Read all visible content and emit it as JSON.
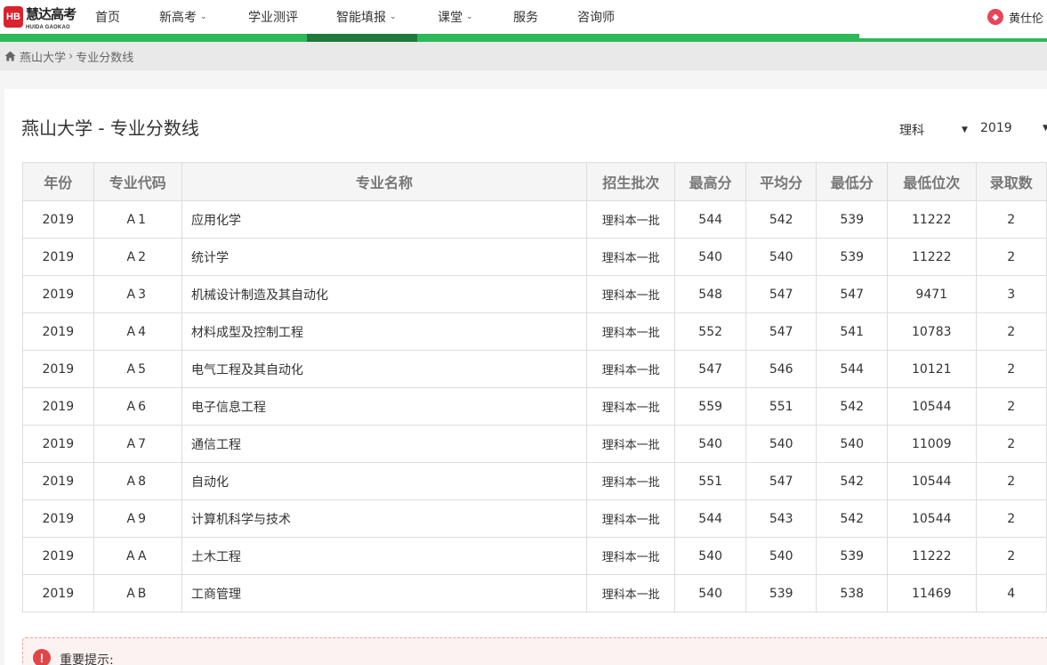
{
  "header": {
    "logo_badge": "HB",
    "logo_cn": "慧达高考",
    "logo_en": "HUIDA GAOKAO",
    "nav": [
      {
        "label": "首页",
        "dropdown": false
      },
      {
        "label": "新高考",
        "dropdown": true
      },
      {
        "label": "学业测评",
        "dropdown": false
      },
      {
        "label": "智能填报",
        "dropdown": true,
        "active": true
      },
      {
        "label": "课堂",
        "dropdown": true
      },
      {
        "label": "服务",
        "dropdown": false
      },
      {
        "label": "咨询师",
        "dropdown": false
      }
    ],
    "user_name": "黄仕伦",
    "accent_color": "#2fb85a",
    "active_color": "#1f7a3c"
  },
  "breadcrumb": {
    "home_icon": "home-icon",
    "items": [
      "燕山大学",
      "专业分数线"
    ]
  },
  "page": {
    "title": "燕山大学 - 专业分数线",
    "subject_select": "理科",
    "year_select": "2019"
  },
  "table": {
    "headers": [
      "年份",
      "专业代码",
      "专业名称",
      "招生批次",
      "最高分",
      "平均分",
      "最低分",
      "最低位次",
      "录取数"
    ],
    "rows": [
      [
        "2019",
        "A1",
        "应用化学",
        "理科本一批",
        "544",
        "542",
        "539",
        "11222",
        "2"
      ],
      [
        "2019",
        "A2",
        "统计学",
        "理科本一批",
        "540",
        "540",
        "539",
        "11222",
        "2"
      ],
      [
        "2019",
        "A3",
        "机械设计制造及其自动化",
        "理科本一批",
        "548",
        "547",
        "547",
        "9471",
        "3"
      ],
      [
        "2019",
        "A4",
        "材料成型及控制工程",
        "理科本一批",
        "552",
        "547",
        "541",
        "10783",
        "2"
      ],
      [
        "2019",
        "A5",
        "电气工程及其自动化",
        "理科本一批",
        "547",
        "546",
        "544",
        "10121",
        "2"
      ],
      [
        "2019",
        "A6",
        "电子信息工程",
        "理科本一批",
        "559",
        "551",
        "542",
        "10544",
        "2"
      ],
      [
        "2019",
        "A7",
        "通信工程",
        "理科本一批",
        "540",
        "540",
        "540",
        "11009",
        "2"
      ],
      [
        "2019",
        "A8",
        "自动化",
        "理科本一批",
        "551",
        "547",
        "542",
        "10544",
        "2"
      ],
      [
        "2019",
        "A9",
        "计算机科学与技术",
        "理科本一批",
        "544",
        "543",
        "542",
        "10544",
        "2"
      ],
      [
        "2019",
        "AA",
        "土木工程",
        "理科本一批",
        "540",
        "540",
        "539",
        "11222",
        "2"
      ],
      [
        "2019",
        "AB",
        "工商管理",
        "理科本一批",
        "540",
        "539",
        "538",
        "11469",
        "4"
      ]
    ]
  },
  "notice": {
    "icon": "exclamation-icon",
    "label": "重要提示:"
  }
}
